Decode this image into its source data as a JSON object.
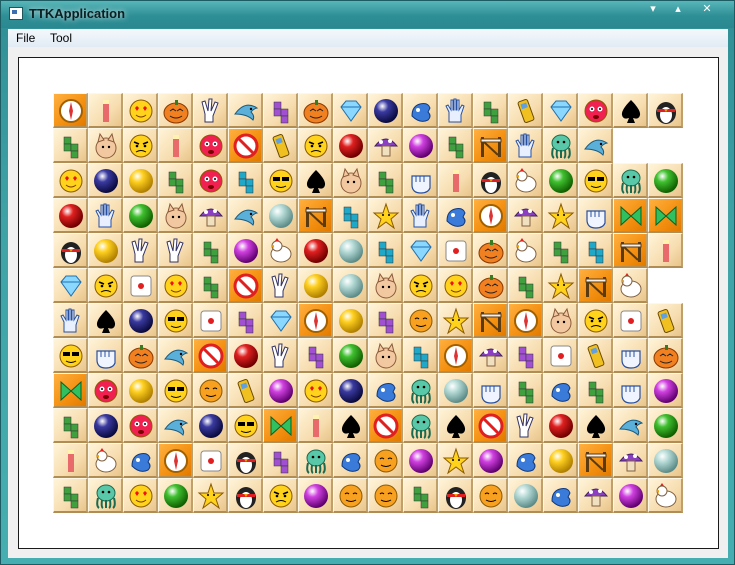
{
  "window": {
    "title": "TTKApplication",
    "minimize_glyph": "▾",
    "maximize_glyph": "▴",
    "close_glyph": "✕"
  },
  "menu": [
    {
      "label": "File"
    },
    {
      "label": "Tool"
    }
  ],
  "board": {
    "rows": 12,
    "cols": 18,
    "tiles": [
      [
        "compass",
        "candle",
        "heart-face",
        "pumpkin",
        "peace",
        "dolphin",
        "tetris-purple",
        "pumpkin",
        "diamond",
        "ball-navy",
        "glove-blue",
        "hand",
        "tetris-green",
        "phone",
        "diamond",
        "red-face",
        "spade",
        "penguin"
      ],
      [
        "tetris-green",
        "cat",
        "angry-face",
        "candle",
        "red-face",
        "no-sign",
        "phone",
        "angry-face",
        "ball-red",
        "mushroom",
        "ball-purple",
        "tetris-green",
        "gate",
        "hand",
        "octopus",
        "dolphin",
        "",
        ""
      ],
      [
        "heart-face",
        "ball-navy",
        "ball-yellow",
        "tetris-green",
        "red-face",
        "tetris-cyan",
        "sunglasses",
        "spade",
        "cat",
        "tetris-green",
        "fist",
        "candle",
        "penguin",
        "chicken",
        "ball-green",
        "sunglasses",
        "octopus",
        "ball-green"
      ],
      [
        "ball-red",
        "hand",
        "ball-green",
        "cat",
        "mushroom",
        "dolphin",
        "ball-cyan",
        "gate",
        "tetris-cyan",
        "star",
        "hand",
        "glove-blue",
        "compass",
        "mushroom",
        "star",
        "fist",
        "bowtie",
        "bowtie"
      ],
      [
        "penguin",
        "ball-yellow",
        "peace",
        "peace",
        "tetris-green",
        "ball-purple",
        "chicken",
        "ball-red",
        "ball-cyan",
        "tetris-cyan",
        "diamond",
        "dice",
        "pumpkin",
        "chicken",
        "tetris-green",
        "tetris-cyan",
        "gate",
        "candle"
      ],
      [
        "diamond",
        "angry-face",
        "dice",
        "heart-face",
        "tetris-green",
        "no-sign",
        "peace",
        "ball-yellow",
        "ball-cyan",
        "cat",
        "angry-face",
        "heart-face",
        "pumpkin",
        "tetris-green",
        "star",
        "gate",
        "chicken",
        ""
      ],
      [
        "hand",
        "spade",
        "ball-navy",
        "sunglasses",
        "dice",
        "tetris-purple",
        "diamond",
        "compass",
        "ball-yellow",
        "tetris-purple",
        "orange-face",
        "star",
        "gate",
        "compass",
        "cat",
        "angry-face",
        "dice",
        "phone"
      ],
      [
        "sunglasses",
        "fist",
        "pumpkin",
        "dolphin",
        "no-sign",
        "ball-red",
        "peace",
        "tetris-purple",
        "ball-green",
        "cat",
        "tetris-cyan",
        "compass",
        "mushroom",
        "tetris-purple",
        "dice",
        "phone",
        "fist",
        "pumpkin"
      ],
      [
        "bowtie",
        "red-face",
        "ball-yellow",
        "sunglasses",
        "orange-face",
        "phone",
        "ball-purple",
        "heart-face",
        "ball-navy",
        "glove-blue",
        "octopus",
        "ball-cyan",
        "fist",
        "tetris-green",
        "glove-blue",
        "tetris-green",
        "fist",
        "ball-purple"
      ],
      [
        "tetris-green",
        "ball-navy",
        "red-face",
        "dolphin",
        "ball-navy",
        "sunglasses",
        "bowtie",
        "candle",
        "spade",
        "no-sign",
        "octopus",
        "spade",
        "no-sign",
        "peace",
        "ball-red",
        "spade",
        "dolphin",
        "ball-green"
      ],
      [
        "candle",
        "chicken",
        "glove-blue",
        "compass",
        "dice",
        "penguin",
        "tetris-purple",
        "octopus",
        "glove-blue",
        "orange-face",
        "ball-purple",
        "star",
        "ball-purple",
        "glove-blue",
        "ball-yellow",
        "gate",
        "mushroom",
        "ball-cyan"
      ],
      [
        "tetris-green",
        "octopus",
        "heart-face",
        "ball-green",
        "star",
        "penguin",
        "angry-face",
        "ball-purple",
        "orange-face",
        "orange-face",
        "tetris-green",
        "penguin",
        "orange-face",
        "ball-cyan",
        "glove-blue",
        "mushroom",
        "ball-purple",
        "chicken"
      ]
    ]
  },
  "icon_colors": {
    "tile_orange": "#f39a1e",
    "tile_cream": "#f7ddb0"
  }
}
